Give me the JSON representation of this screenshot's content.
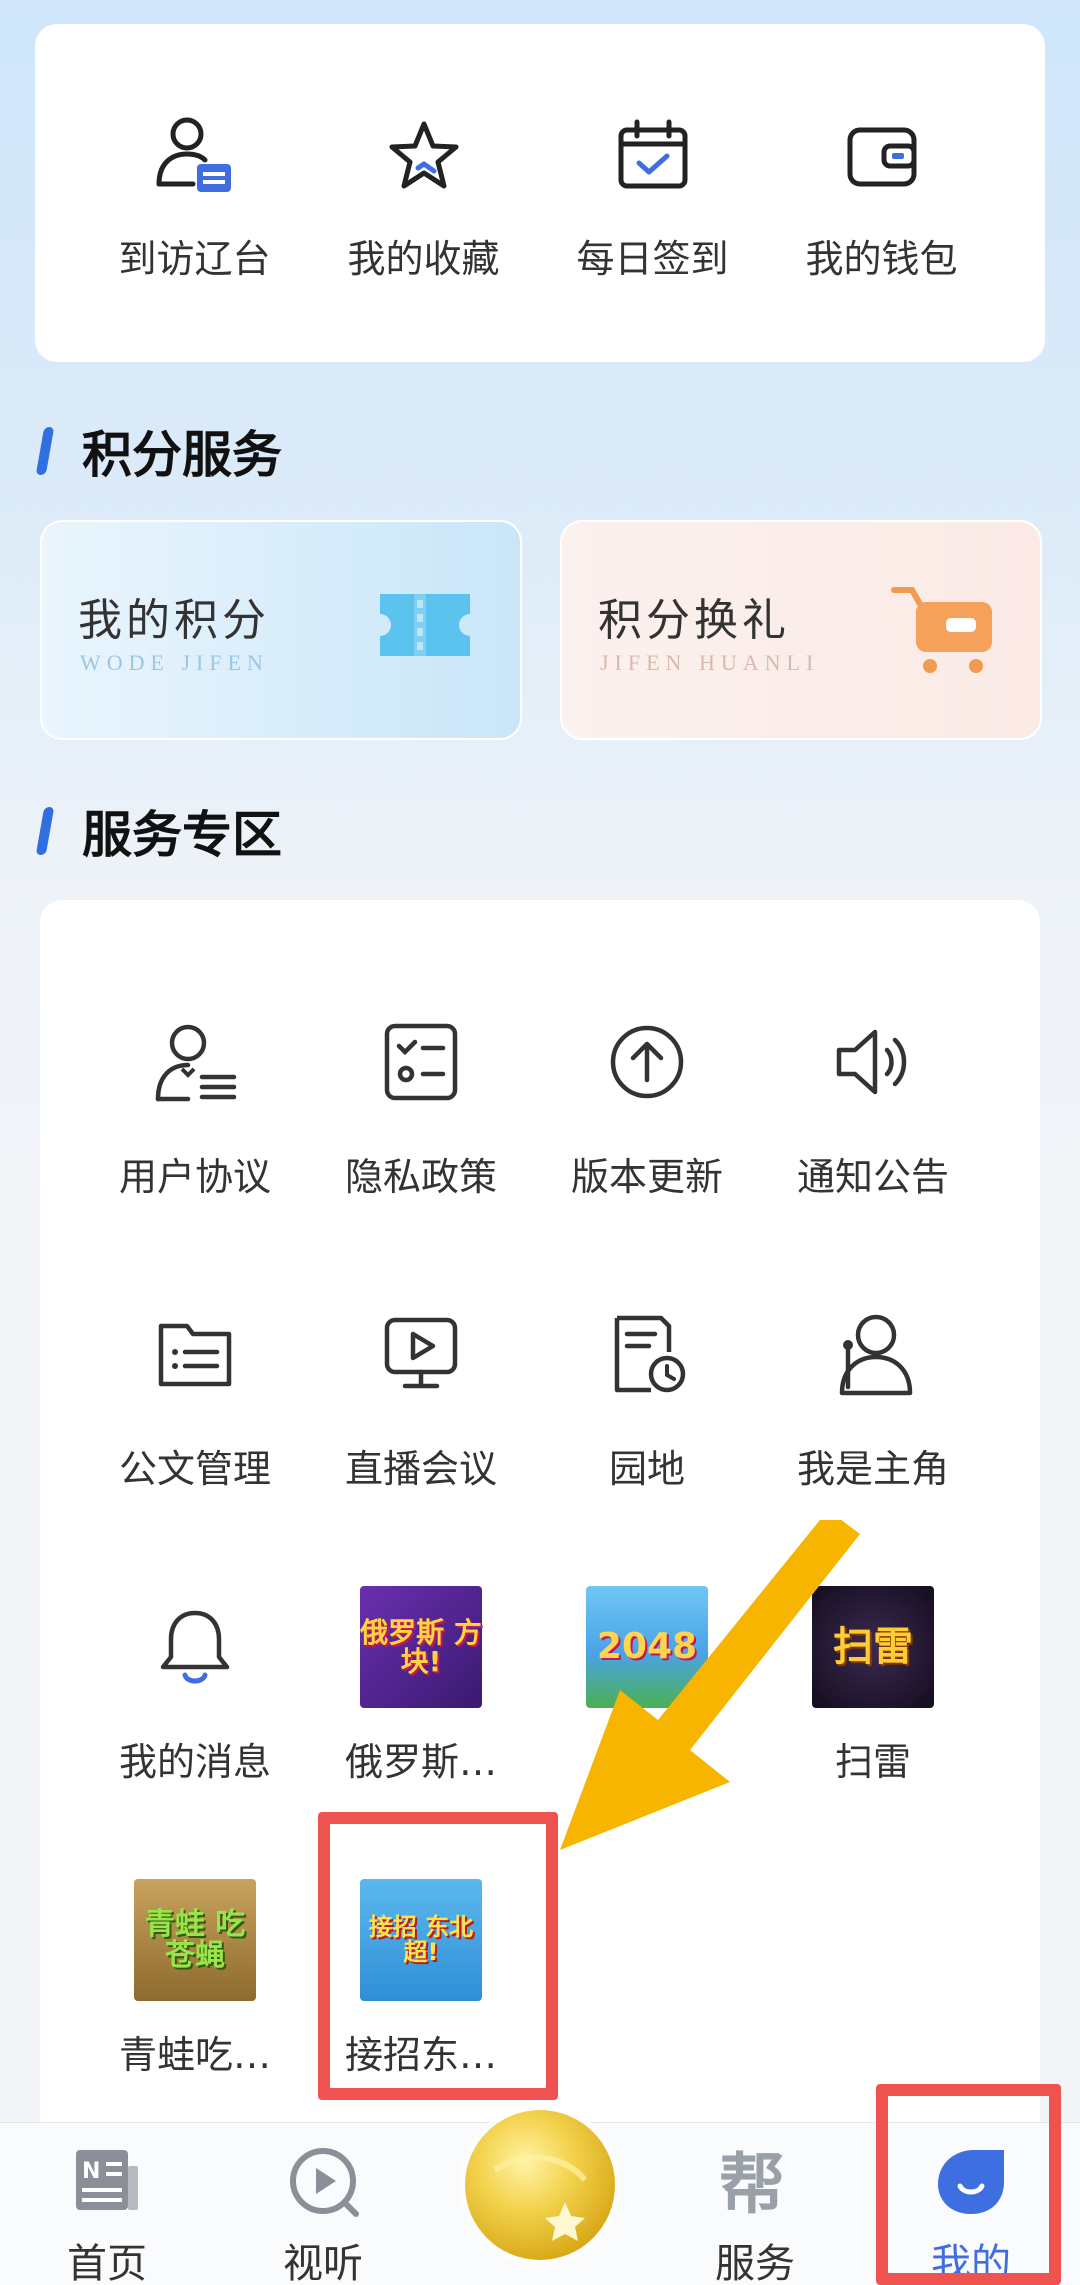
{
  "quick": {
    "items": [
      {
        "label": "到访辽台",
        "icon": "person-card-icon"
      },
      {
        "label": "我的收藏",
        "icon": "star-icon"
      },
      {
        "label": "每日签到",
        "icon": "calendar-check-icon"
      },
      {
        "label": "我的钱包",
        "icon": "wallet-icon"
      }
    ]
  },
  "points": {
    "title": "积分服务",
    "my_points": {
      "title": "我的积分",
      "sub": "WODE JIFEN"
    },
    "exchange": {
      "title": "积分换礼",
      "sub": "JIFEN HUANLI"
    }
  },
  "service": {
    "title": "服务专区",
    "row1": [
      {
        "label": "用户协议"
      },
      {
        "label": "隐私政策"
      },
      {
        "label": "版本更新"
      },
      {
        "label": "通知公告"
      }
    ],
    "row2": [
      {
        "label": "公文管理"
      },
      {
        "label": "直播会议"
      },
      {
        "label": "园地"
      },
      {
        "label": "我是主角"
      }
    ],
    "row3": [
      {
        "label": "我的消息"
      },
      {
        "label": "俄罗斯…",
        "art": "俄罗斯 方块!"
      },
      {
        "label": "…",
        "art": "2048"
      },
      {
        "label": "扫雷",
        "art": "扫雷"
      }
    ],
    "row4": [
      {
        "label": "青蛙吃…",
        "art": "青蛙 吃苍蝇"
      },
      {
        "label": "接招东…",
        "art": "接招 东北超!"
      }
    ]
  },
  "tabbar": {
    "home": "首页",
    "watch": "视听",
    "service": "服务",
    "mine": "我的"
  },
  "colors": {
    "accent": "#3f6ee0",
    "highlight": "#ef5350",
    "arrow": "#f7b500"
  }
}
